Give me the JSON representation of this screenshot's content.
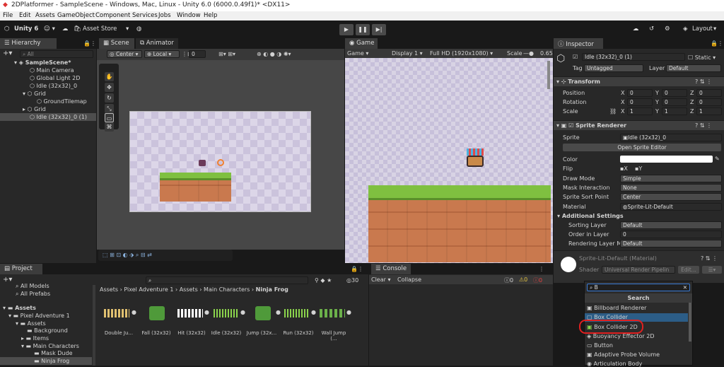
{
  "window": {
    "title": "2DPlatformer - SampleScene - Windows, Mac, Linux - Unity 6.0 (6000.0.49f1)* <DX11>"
  },
  "menu": [
    "File",
    "Edit",
    "Assets",
    "GameObject",
    "Component",
    "Services",
    "Jobs",
    "Window",
    "Help"
  ],
  "toolbar": {
    "unity": "Unity 6",
    "asset_store": "Asset Store",
    "layout": "Layout"
  },
  "hierarchy": {
    "tab": "Hierarchy",
    "search_placeholder": "All",
    "items": [
      "SampleScene*",
      "Main Camera",
      "Global Light 2D",
      "Idle (32x32)_0",
      "Grid",
      "GroundTilemap",
      "Grid",
      "Idle (32x32)_0 (1)"
    ]
  },
  "scene": {
    "tabs": [
      "Scene",
      "Animator"
    ],
    "pivot": "Center",
    "space": "Local",
    "snap": "0"
  },
  "game": {
    "tab": "Game",
    "mode": "Game",
    "display": "Display 1",
    "resolution": "Full HD (1920x1080)",
    "scale_label": "Scale",
    "scale_value": "0.65"
  },
  "inspector": {
    "tab": "Inspector",
    "object_name": "Idle (32x32)_0 (1)",
    "static": "Static",
    "tag_label": "Tag",
    "tag": "Untagged",
    "layer_label": "Layer",
    "layer": "Default",
    "transform": {
      "title": "Transform",
      "position_label": "Position",
      "rotation_label": "Rotation",
      "scale_label": "Scale",
      "position": [
        "0",
        "0",
        "0"
      ],
      "rotation": [
        "0",
        "0",
        "0"
      ],
      "scale": [
        "1",
        "1",
        "1"
      ],
      "axes": [
        "X",
        "Y",
        "Z"
      ]
    },
    "sprite_renderer": {
      "title": "Sprite Renderer",
      "sprite_label": "Sprite",
      "sprite": "Idle (32x32)_0",
      "open_editor": "Open Sprite Editor",
      "color_label": "Color",
      "flip_label": "Flip",
      "flip_x": "X",
      "flip_y": "Y",
      "draw_mode_label": "Draw Mode",
      "draw_mode": "Simple",
      "mask_label": "Mask Interaction",
      "mask": "None",
      "sort_point_label": "Sprite Sort Point",
      "sort_point": "Center",
      "material_label": "Material",
      "material": "Sprite-Lit-Default",
      "additional": "Additional Settings",
      "sorting_layer_label": "Sorting Layer",
      "sorting_layer": "Default",
      "order_label": "Order in Layer",
      "order": "0",
      "rendering_layer_label": "Rendering Layer M",
      "rendering_layer": "Default"
    },
    "material_section": {
      "name": "Sprite-Lit-Default (Material)",
      "shader_label": "Shader",
      "shader": "Universal Render Pipelin",
      "edit": "Edit..."
    },
    "add_component": {
      "search_value": "B",
      "header": "Search",
      "items": [
        "Billboard Renderer",
        "Box Collider",
        "Box Collider 2D",
        "Buoyancy Effector 2D",
        "Button",
        "Adaptive Probe Volume",
        "Articulation Body"
      ],
      "selected": "Box Collider"
    }
  },
  "project": {
    "tab": "Project",
    "count": "30",
    "tree": [
      "All Models",
      "All Prefabs",
      "Assets",
      "Pixel Adventure 1",
      "Assets",
      "Background",
      "Items",
      "Main Characters",
      "Mask Dude",
      "Ninja Frog"
    ],
    "breadcrumb": [
      "Assets",
      "Pixel Adventure 1",
      "Assets",
      "Main Characters",
      "Ninja Frog"
    ],
    "assets": [
      "Double Ju...",
      "Fall (32x32)",
      "Hit (32x32)",
      "Idle (32x32)",
      "Jump (32x...",
      "Run (32x32)",
      "Wall Jump (..."
    ]
  },
  "console": {
    "tab": "Console",
    "clear": "Clear",
    "collapse": "Collapse",
    "counts": [
      "0",
      "0",
      "0"
    ]
  },
  "colors": {
    "highlight": "#2c5d87",
    "selected_item": "#3d6fa6",
    "red_annotation": "#e02020",
    "grass": "#7fc040",
    "dirt": "#c9794e"
  }
}
